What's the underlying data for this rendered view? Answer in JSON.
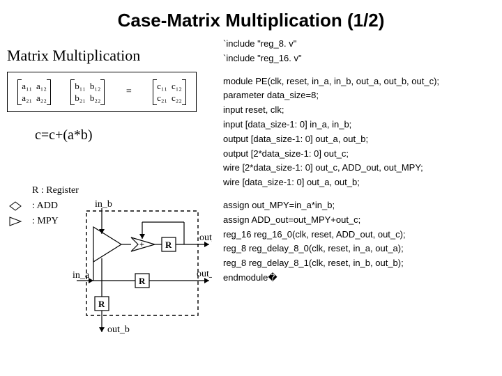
{
  "title": "Case-Matrix Multiplication (1/2)",
  "left": {
    "subtitle": "Matrix Multiplication",
    "matrix": {
      "a": [
        "a₁₁",
        "a₁₂",
        "a₂₁",
        "a₂₂"
      ],
      "b": [
        "b₁₁",
        "b₁₂",
        "b₂₁",
        "b₂₂"
      ],
      "c": [
        "c₁₁",
        "c₁₂",
        "c₂₁",
        "c₂₂"
      ],
      "eq": "="
    },
    "formula": "c=c+(a*b)",
    "legend": {
      "reg_text": "R  : Register",
      "add_text": ": ADD",
      "mpy_text": ": MPY"
    },
    "diagram": {
      "in_b": "in_b",
      "in_a": "in_a",
      "out_c": "out_c",
      "out_a": "out_a",
      "out_b": "out_b",
      "plus": "+",
      "R": "R"
    }
  },
  "right": {
    "lines": [
      "`include \"reg_8. v\"",
      "`include \"reg_16. v\"",
      "",
      "module PE(clk, reset, in_a, in_b, out_a, out_b, out_c);",
      "parameter data_size=8;",
      "input        reset, clk;",
      "input        [data_size-1: 0] in_a, in_b;",
      "output      [data_size-1: 0] out_a, out_b;",
      "output      [2*data_size-1: 0] out_c;",
      "wire         [2*data_size-1: 0] out_c, ADD_out, out_MPY;",
      "wire         [data_size-1: 0] out_a, out_b;",
      "",
      "assign out_MPY=in_a*in_b;",
      "assign ADD_out=out_MPY+out_c;",
      "reg_16 reg_16_0(clk, reset, ADD_out, out_c);",
      "reg_8 reg_delay_8_0(clk, reset, in_a, out_a);",
      "reg_8 reg_delay_8_1(clk, reset, in_b, out_b);",
      "endmodule�"
    ]
  }
}
